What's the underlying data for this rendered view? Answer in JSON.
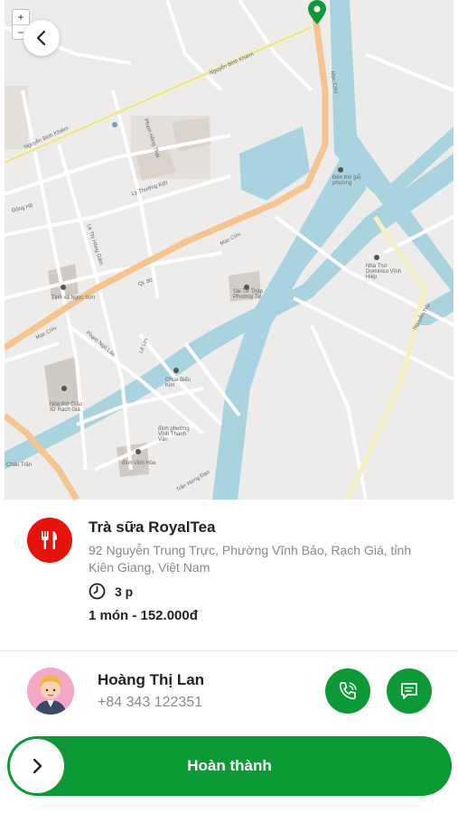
{
  "map": {
    "zoom_in": "+",
    "zoom_out": "−",
    "labels": {
      "nguyen_binh_khiem_1": "Nguyễn Bỉnh Khiêm",
      "nguyen_binh_khiem_2": "Nguyễn Bỉnh Khiêm",
      "mac_cuu_1": "Mạc Cửu",
      "mac_cuu_2": "Mạc Cửu",
      "mac_cuu_3": "Mạc Cửu",
      "ly_thuong_kiet": "Lý Thường Kiệt",
      "pham_hong_thai": "Phạm Hồng Thái",
      "dong_ho": "Đông Hồ",
      "le_thi_hong_gam": "Lê Thị Hồng Gấm",
      "ql80": "QL 80",
      "pham_ngu_lao": "Phạm Ngũ Lão",
      "tinh_xa": "Tịnh xá Ngọc Sơn",
      "nha_tho_giao_xu": "Nhà thờ Giáo xứ Rạch Giá",
      "chua_bieu_kim": "Chùa Biểu Kim",
      "den_tho": "Đền thờ giỗ phường",
      "sai_to": "Sài Tờ Thập Phương Tự",
      "nha_tho_dominico": "Nhà Thờ Dominico Vĩnh Hiệp",
      "dinh_vinh_hoa": "đình vĩnh Hòa",
      "dinh_thanh_van": "đình phường Vĩnh Thanh Vân",
      "chau_tran": "Châu Trần",
      "le_loi": "Lê Lợi",
      "tran_hung_dao": "Trần Hưng Đạo",
      "nguyen_trai": "Nguyễn Trãi"
    }
  },
  "store": {
    "name": "Trà sữa RoyalTea",
    "address": "92 Nguyễn Trung Trực, Phường Vĩnh Bảo, Rạch Giá, tỉnh Kiên Giang, Việt Nam",
    "eta": "3 p",
    "order_summary": "1 món - 152.000đ"
  },
  "customer": {
    "name": "Hoàng Thị Lan",
    "phone": "+84 343 122351"
  },
  "actions": {
    "complete_label": "Hoàn thành"
  },
  "colors": {
    "accent_green": "#0d9a36",
    "store_red": "#e8120c",
    "water": "#a9d3de",
    "major_road": "#f5c48f"
  },
  "icons": [
    "chevron-left-icon",
    "location-pin-icon",
    "fork-knife-icon",
    "clock-icon",
    "phone-icon",
    "chat-icon",
    "chevron-right-icon"
  ]
}
